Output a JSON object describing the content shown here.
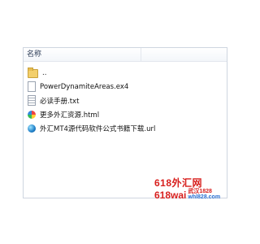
{
  "explorer": {
    "column_header": "名称",
    "files": [
      {
        "name": "..",
        "icon": "folder-up-icon"
      },
      {
        "name": "PowerDynamiteAreas.ex4",
        "icon": "file-icon"
      },
      {
        "name": "必读手册.txt",
        "icon": "text-file-icon"
      },
      {
        "name": "更多外汇资源.html",
        "icon": "html-file-icon"
      },
      {
        "name": "外汇MT4源代码软件公式书籍下载.url",
        "icon": "url-globe-icon"
      }
    ]
  },
  "watermark": {
    "line1": "618外汇网",
    "code": "618wai",
    "city": "武汉1828",
    "domain": "whl828.com",
    "color_primary": "#d8201e",
    "color_secondary": "#2a6fd1"
  }
}
